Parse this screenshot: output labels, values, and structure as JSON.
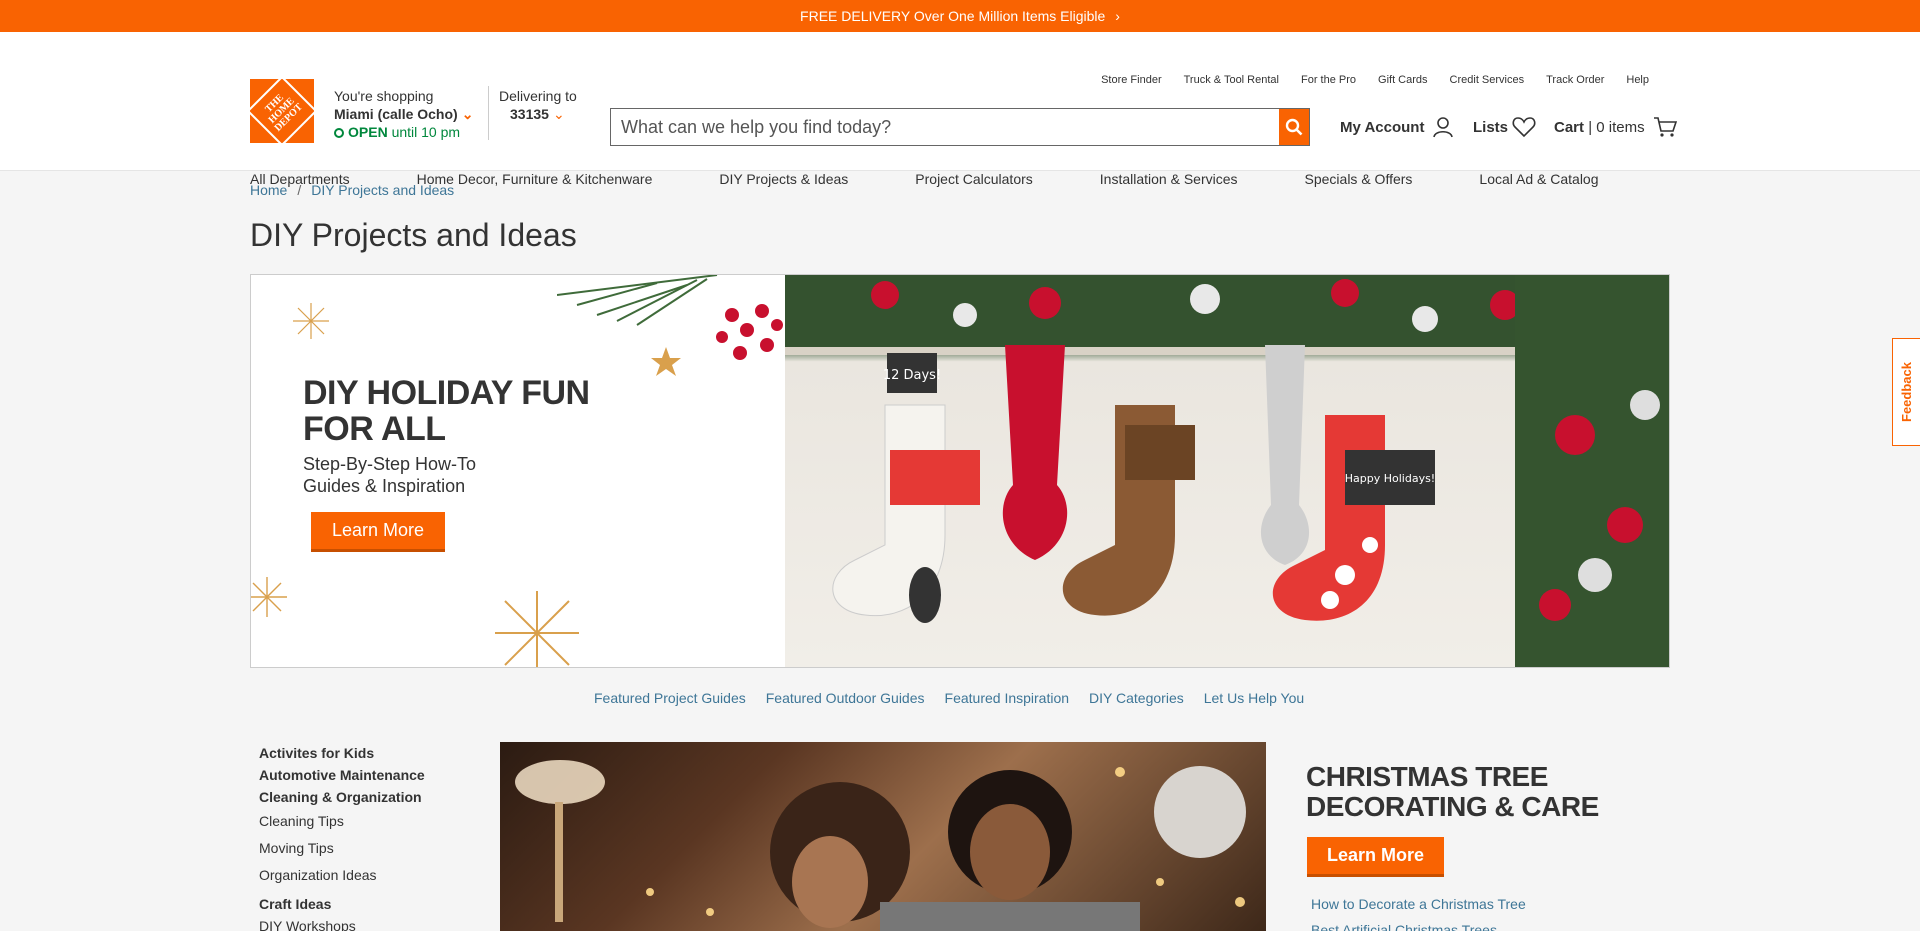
{
  "promo_bar": {
    "text": "FREE DELIVERY Over One Million Items Eligible"
  },
  "logo": {
    "text": "THE HOME DEPOT"
  },
  "store": {
    "label": "You're shopping",
    "name": "Miami (calle Ocho)",
    "status_open": "OPEN",
    "status_rest": "until 10 pm"
  },
  "delivery": {
    "label": "Delivering to",
    "zip": "33135"
  },
  "utility_links": [
    "Store Finder",
    "Truck & Tool Rental",
    "For the Pro",
    "Gift Cards",
    "Credit Services",
    "Track Order",
    "Help"
  ],
  "search": {
    "placeholder": "What can we help you find today?"
  },
  "account": {
    "my_account": "My Account",
    "lists": "Lists",
    "cart": "Cart",
    "cart_sep": "|",
    "cart_items": "0 items"
  },
  "nav": [
    "All Departments",
    "Home Decor, Furniture & Kitchenware",
    "DIY Projects & Ideas",
    "Project Calculators",
    "Installation & Services",
    "Specials & Offers",
    "Local Ad & Catalog"
  ],
  "breadcrumb": {
    "home": "Home",
    "sep": "/",
    "current": "DIY Projects and Ideas"
  },
  "page_title": "DIY Projects and Ideas",
  "hero": {
    "headline_1": "DIY HOLIDAY FUN",
    "headline_2": "FOR ALL",
    "sub_1": "Step-By-Step How-To",
    "sub_2": "Guides & Inspiration",
    "cta": "Learn More",
    "sign_text": "12 Days!",
    "chalk_text": "Happy Holidays!"
  },
  "anchor_links": [
    "Featured Project Guides",
    "Featured Outdoor Guides",
    "Featured Inspiration",
    "DIY Categories",
    "Let Us Help You"
  ],
  "sidebar": [
    {
      "label": "Activites for Kids",
      "heading": true
    },
    {
      "label": "Automotive Maintenance",
      "heading": true
    },
    {
      "label": "Cleaning & Organization",
      "heading": true
    },
    {
      "label": "Cleaning Tips",
      "heading": false
    },
    {
      "label": "Moving Tips",
      "heading": false
    },
    {
      "label": "Organization Ideas",
      "heading": false
    },
    {
      "label": "Craft Ideas",
      "heading": true
    },
    {
      "label": "DIY Workshops",
      "heading": false
    }
  ],
  "feature": {
    "headline_1": "CHRISTMAS TREE",
    "headline_2": "DECORATING & CARE",
    "cta": "Learn More",
    "link_1": "How to Decorate a Christmas Tree",
    "link_2": "Best Artificial Christmas Trees"
  },
  "feedback": {
    "label": "Feedback"
  },
  "colors": {
    "brand": "#f96302",
    "link": "#3e7697",
    "open_green": "#00873c"
  }
}
